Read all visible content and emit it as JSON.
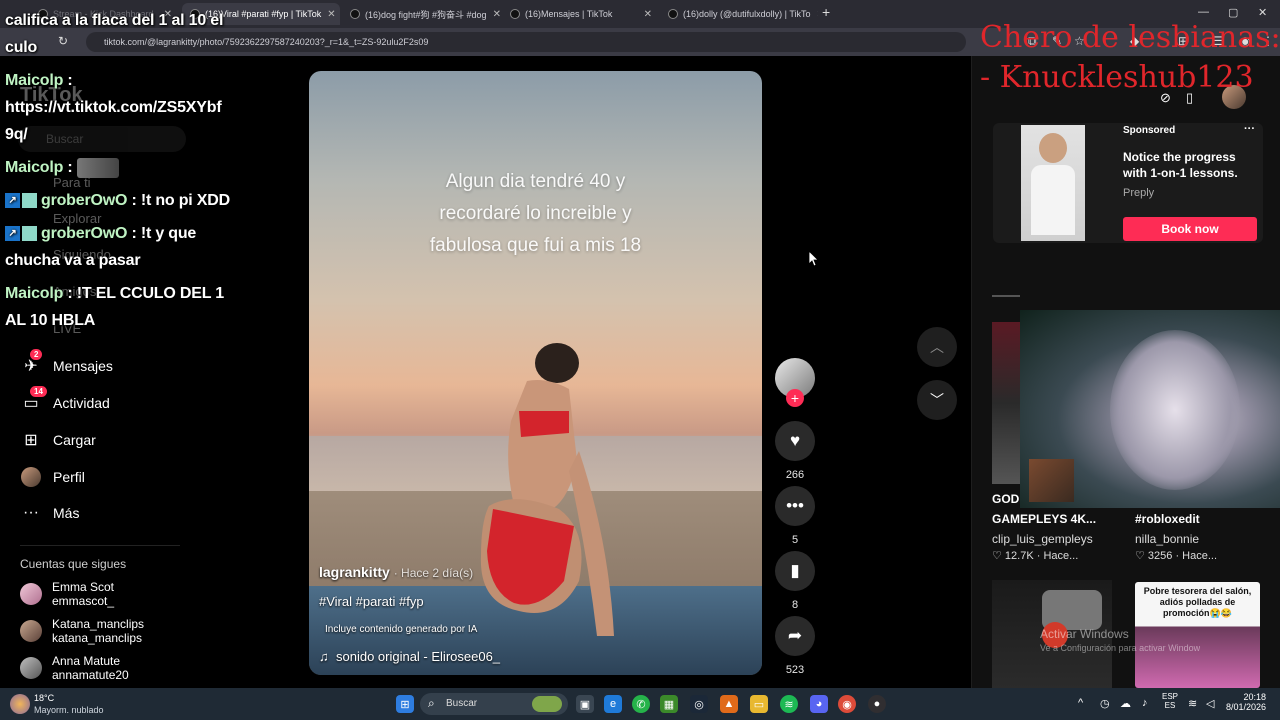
{
  "browser": {
    "tabs": [
      {
        "title": "Stream - Kick Dashboard"
      },
      {
        "title": "(16)Viral #parati #fyp | TikTok"
      },
      {
        "title": "(16)dog fight#狗 #狗奋斗 #dog"
      },
      {
        "title": "(16)Mensajes | TikTok"
      },
      {
        "title": "(16)dolly (@dutifulxdolly) | TikTo"
      }
    ],
    "new_tab": "+",
    "url": "tiktok.com/@lagrankitty/photo/7592362297587240203?_r=1&_t=ZS-92ulu2F2s09",
    "window_controls": [
      "—",
      "▢",
      "✕"
    ]
  },
  "chat": [
    {
      "text": "califica a la flaca del 1 al 10 el"
    },
    {
      "text": "culo"
    },
    {
      "user": "Maicolp",
      "sep": " :"
    },
    {
      "text": "https://vt.tiktok.com/ZS5XYbf"
    },
    {
      "text": "9q/"
    },
    {
      "user": "Maicolp",
      "sep": " :"
    },
    {
      "user": "groberOwO",
      "sep": " : ",
      "msg": "!t no pi XDD"
    },
    {
      "user": "groberOwO",
      "sep": " : ",
      "msg": "!t y que"
    },
    {
      "text": "chucha va a pasar"
    },
    {
      "user": "Maicolp",
      "sep": " : ",
      "msg": "!T EL CCULO DEL 1"
    },
    {
      "text": "AL 10 HBLA"
    }
  ],
  "sidebar": {
    "logo": "TikTok",
    "search_placeholder": "Buscar",
    "items_faded": [
      {
        "label": "Para ti"
      },
      {
        "label": "Explorar"
      },
      {
        "label": "Siguiendo"
      },
      {
        "label": "Amigos"
      },
      {
        "label": "LIVE"
      }
    ],
    "items": [
      {
        "label": "Mensajes",
        "badge": "2",
        "icon": "send-icon"
      },
      {
        "label": "Actividad",
        "badge": "14",
        "icon": "inbox-icon"
      },
      {
        "label": "Cargar",
        "icon": "upload-icon"
      },
      {
        "label": "Perfil",
        "icon": "avatar"
      },
      {
        "label": "Más",
        "icon": "more-icon"
      }
    ],
    "following_title": "Cuentas que sigues",
    "following": [
      {
        "name": "Emma Scot",
        "handle": "emmascot_"
      },
      {
        "name": "Katana_manclips",
        "handle": "katana_manclips"
      },
      {
        "name": "Anna Matute",
        "handle": "annamatute20"
      }
    ]
  },
  "video": {
    "overlay_lines": [
      "Algun dia tendré 40 y",
      "recordaré lo increible y",
      "fabulosa que fui a mis 18"
    ],
    "author": "lagrankitty",
    "time": "· Hace 2 día(s)",
    "hashtags": "#Viral #parati #fyp",
    "ai_notice": "Incluye contenido generado por IA",
    "sound": "sonido original - Elirosee06_"
  },
  "actions": {
    "likes": "266",
    "comments": "5",
    "saves": "8",
    "shares": "523"
  },
  "right_panel": {
    "overlay_text_line1": "Chero de lesbianas:",
    "overlay_text_line2": "- Knuckleshub123",
    "ad": {
      "sponsored": "Sponsored",
      "headline": "Notice the progress with 1-on-1 lessons.",
      "brand": "Preply",
      "cta": "Book now",
      "more": "···"
    },
    "cards": [
      {
        "title_prefix": "GOD",
        "title": "GAMEPLEYS 4K...",
        "user": "clip_luis_gempleys",
        "stats": "♡ 12.7K · Hace..."
      },
      {
        "title": "#robloxedit",
        "user": "nilla_bonnie",
        "stats": "♡ 3256 · Hace..."
      }
    ],
    "card2_caption": "Pobre tesorera del salón, adiós polladas de promoción😭😂",
    "watermark_line1": "Activar Windows",
    "watermark_line2": "Ve a Configuración para activar Windows."
  },
  "taskbar": {
    "weather_temp": "18°C",
    "weather_desc": "Mayorm. nublado",
    "search_placeholder": "Buscar",
    "lang_top": "ESP",
    "lang_bottom": "ES",
    "time": "20:18",
    "date": "8/01/2026"
  },
  "colors": {
    "accent": "#fe2c55",
    "username_green": "#bff3c3",
    "overlay_red": "#e0262b"
  }
}
